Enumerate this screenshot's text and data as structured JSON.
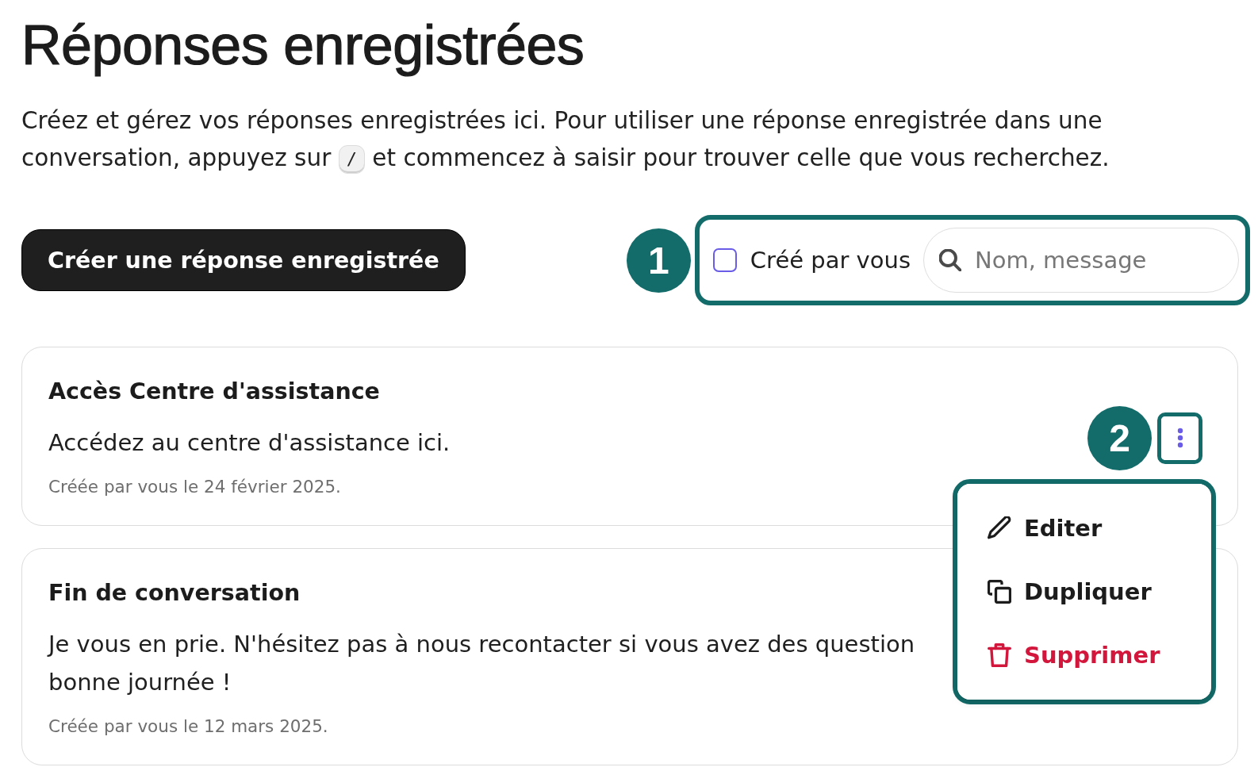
{
  "page": {
    "title": "Réponses enregistrées",
    "description": {
      "before": "Créez et gérez vos réponses enregistrées ici. Pour utiliser une réponse enregistrée dans une conversation, appuyez sur",
      "key": "/",
      "after": "et commencez à saisir pour trouver celle que vous recherchez."
    }
  },
  "toolbar": {
    "create_button": "Créer une réponse enregistrée",
    "filter": {
      "annotation": "1",
      "highlighted": true,
      "checkbox": {
        "label": "Créé par vous",
        "checked": false
      },
      "search": {
        "placeholder": "Nom, message"
      }
    }
  },
  "responses": [
    {
      "title": "Accès Centre d'assistance",
      "message_lines": [
        "Accédez au centre d'assistance ici."
      ],
      "meta": "Créée par vous le 24 février 2025.",
      "actions": {
        "annotation": "2",
        "highlighted": true,
        "menu": {
          "highlighted": true,
          "items": [
            {
              "kind": "edit",
              "label": "Editer"
            },
            {
              "kind": "duplicate",
              "label": "Dupliquer"
            },
            {
              "kind": "delete",
              "label": "Supprimer"
            }
          ]
        }
      }
    },
    {
      "title": "Fin de conversation",
      "message_lines": [
        "Je vous en prie. N'hésitez pas à nous recontacter si vous avez des question",
        "bonne journée !"
      ],
      "meta": "Créée par vous le 12 mars 2025."
    }
  ]
}
